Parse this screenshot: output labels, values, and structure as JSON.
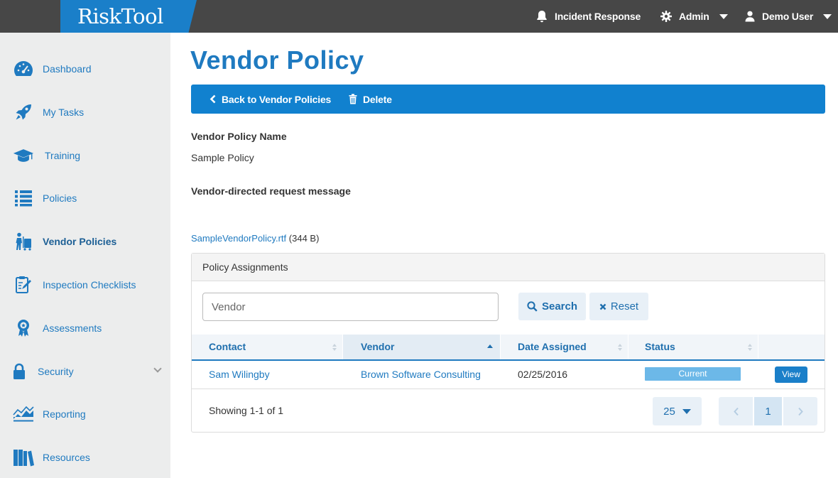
{
  "app": {
    "logo": "RiskTool"
  },
  "topbar": {
    "incident": "Incident Response",
    "admin": "Admin",
    "user": "Demo User"
  },
  "sidebar": {
    "items": [
      {
        "label": "Dashboard",
        "icon": "dashboard-icon"
      },
      {
        "label": "My Tasks",
        "icon": "rocket-icon"
      },
      {
        "label": "Training",
        "icon": "graduation-cap-icon"
      },
      {
        "label": "Policies",
        "icon": "list-icon"
      },
      {
        "label": "Vendor Policies",
        "icon": "vendor-icon",
        "active": true
      },
      {
        "label": "Inspection Checklists",
        "icon": "clipboard-icon"
      },
      {
        "label": "Assessments",
        "icon": "ribbon-icon"
      },
      {
        "label": "Security",
        "icon": "lock-icon"
      },
      {
        "label": "Reporting",
        "icon": "chart-icon"
      },
      {
        "label": "Resources",
        "icon": "books-icon"
      }
    ]
  },
  "main": {
    "title": "Vendor Policy",
    "actions": {
      "back": "Back to Vendor Policies",
      "delete": "Delete"
    },
    "name_label": "Vendor Policy Name",
    "name_value": "Sample Policy",
    "message_label": "Vendor-directed request message",
    "file": {
      "name": "SampleVendorPolicy.rtf",
      "size": "(344 B)"
    }
  },
  "assignments": {
    "heading": "Policy Assignments",
    "search_placeholder": "Vendor",
    "search_label": "Search",
    "reset_label": "Reset",
    "columns": [
      "Contact",
      "Vendor",
      "Date Assigned",
      "Status"
    ],
    "rows": [
      {
        "contact": "Sam Wilingby",
        "vendor": "Brown Software Consulting",
        "date": "02/25/2016",
        "status": "Current",
        "action": "View"
      }
    ],
    "showing": "Showing 1-1 of 1",
    "per_page": "25",
    "page": "1"
  },
  "colors": {
    "brand": "#1a7fc9",
    "topbar": "#474747",
    "sidebar": "#eceded",
    "status_current": "#6cb8e8"
  }
}
